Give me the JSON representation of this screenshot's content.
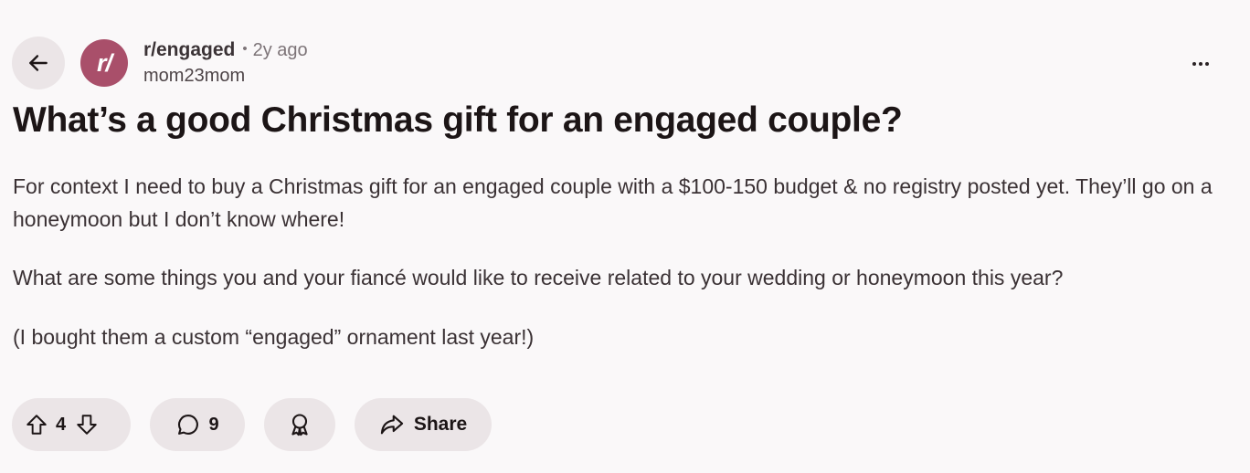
{
  "header": {
    "subreddit": "r/engaged",
    "separator": "•",
    "time_ago": "2y ago",
    "author": "mom23mom",
    "avatar_text": "r/",
    "avatar_color": "#a94f6a"
  },
  "post": {
    "title": "What’s a good Christmas gift for an engaged couple?",
    "paragraphs": [
      "For context I need to buy a Christmas gift for an engaged couple with a $100-150 budget & no registry posted yet. They’ll go on a honeymoon but I don’t know where!",
      "What are some things you and your fiancé would like to receive related to your wedding or honeymoon this year?",
      "(I bought them a custom “engaged” ornament last year!)"
    ]
  },
  "actions": {
    "vote_count": "4",
    "comment_count": "9",
    "share_label": "Share"
  },
  "icons": {
    "back": "arrow-left-icon",
    "more": "more-horizontal-icon",
    "upvote": "upvote-arrow-icon",
    "downvote": "downvote-arrow-icon",
    "comment": "comment-bubble-icon",
    "award": "award-ribbon-icon",
    "share": "share-arrow-icon"
  },
  "colors": {
    "background": "#faf8f9",
    "pill": "#ebe5e7",
    "text": "#1c1516"
  }
}
